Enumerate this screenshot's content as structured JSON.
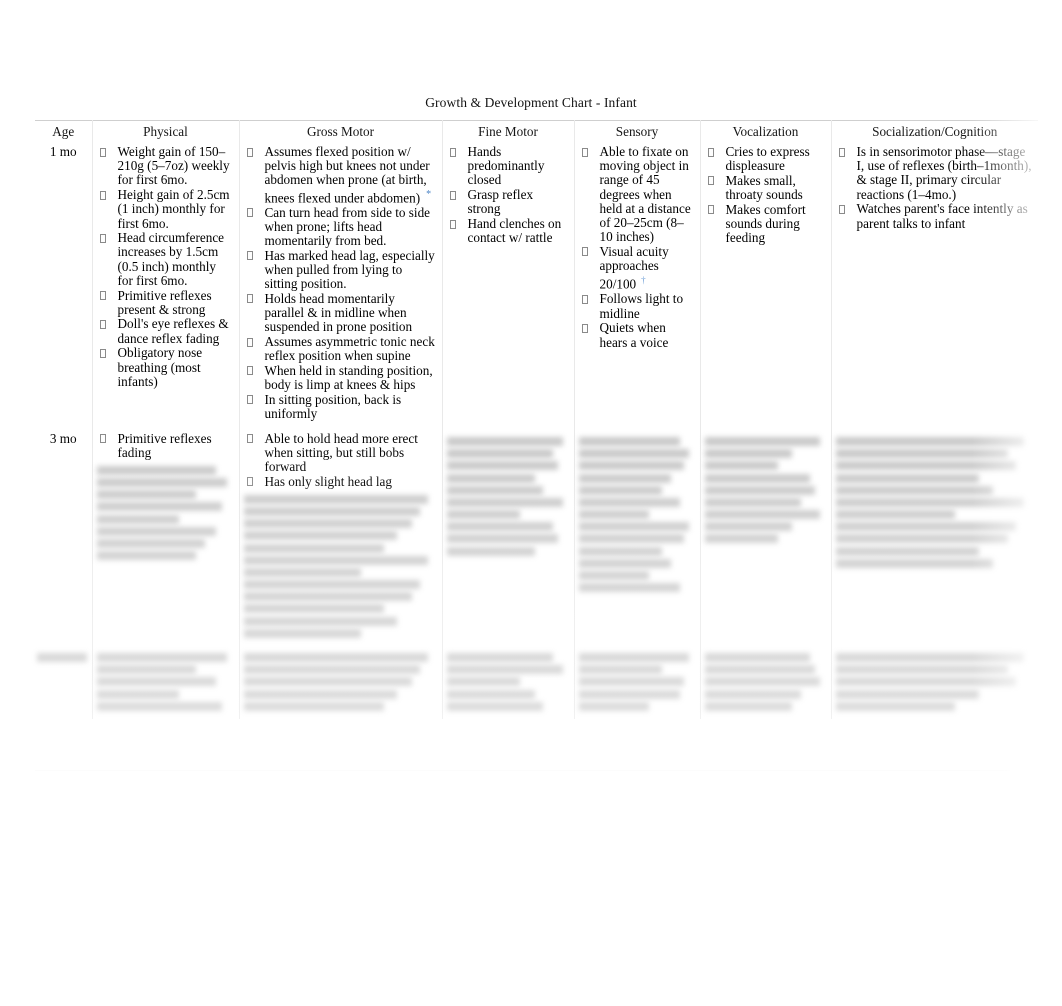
{
  "document": {
    "title": "Growth & Development Chart - Infant"
  },
  "table": {
    "headers": [
      "Age",
      "Physical",
      "Gross Motor",
      "Fine Motor",
      "Sensory",
      "Vocalization",
      "Socialization/Cognition"
    ],
    "rows": [
      {
        "age": "1 mo",
        "physical": [
          "Weight gain of 150–210g (5–7oz) weekly for first 6mo.",
          "Height gain of 2.5cm (1 inch) monthly for first 6mo.",
          "Head circumference increases by 1.5cm (0.5 inch) monthly for first 6mo.",
          "Primitive reflexes present & strong",
          "Doll's eye reflexes & dance reflex fading",
          "Obligatory nose breathing (most infants)"
        ],
        "gross_motor": [
          "Assumes flexed position w/ pelvis high but knees not under abdomen when prone (at birth, knees flexed under abdomen)",
          "Can turn head from side to side when prone; lifts head momentarily from bed.",
          "Has marked head lag, especially when pulled from lying to sitting position.",
          "Holds head momentarily parallel & in midline when suspended in prone position",
          "Assumes asymmetric tonic neck reflex position when supine",
          "When held in standing position, body is limp at knees & hips",
          "In sitting position, back is uniformly"
        ],
        "gross_motor_marks": [
          "*",
          "",
          "",
          "",
          "",
          "",
          ""
        ],
        "fine_motor": [
          "Hands predominantly closed",
          "Grasp reflex strong",
          "Hand clenches on contact w/ rattle"
        ],
        "sensory": [
          "Able to fixate on moving object in range of 45 degrees when held at a distance of 20–25cm (8–10 inches)",
          "Visual acuity approaches 20/100",
          "Follows light to midline",
          "Quiets when hears a voice"
        ],
        "sensory_marks": [
          "",
          "†",
          "",
          ""
        ],
        "vocalization": [
          "Cries to express displeasure",
          "Makes small, throaty sounds",
          "Makes comfort sounds during feeding"
        ],
        "socialization": [
          "Is in sensorimotor phase—stage I, use of reflexes (birth–1month), & stage II, primary circular reactions (1–4mo.)",
          "Watches parent's face intently as parent talks to infant"
        ]
      },
      {
        "age": "3 mo",
        "physical": [
          "Primitive reflexes fading"
        ],
        "gross_motor": [
          "Able to hold head more erect when sitting, but still bobs forward",
          "Has only slight head lag"
        ],
        "fine_motor": [],
        "sensory": [],
        "vocalization": [],
        "socialization": []
      },
      {
        "age": "",
        "physical": [],
        "gross_motor": [],
        "fine_motor": [],
        "sensory": [],
        "vocalization": [],
        "socialization": []
      }
    ]
  },
  "markers": {
    "asterisk": "*",
    "dagger": "†",
    "asterisk_color": "#4f86c6",
    "dagger_color": "#6d9ed6"
  }
}
